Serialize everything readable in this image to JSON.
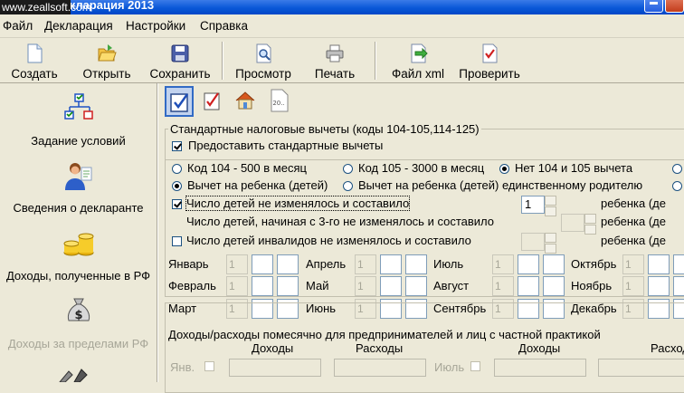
{
  "window": {
    "title": "Декларация 2013",
    "watermark": "www.zeallsoft.com"
  },
  "menu": [
    "Файл",
    "Декларация",
    "Настройки",
    "Справка"
  ],
  "toolbar": {
    "create": "Создать",
    "open": "Открыть",
    "save": "Сохранить",
    "preview": "Просмотр",
    "print": "Печать",
    "xml": "Файл xml",
    "check": "Проверить"
  },
  "sidebar": [
    {
      "label": "Задание условий",
      "icon": "org-chart-icon"
    },
    {
      "label": "Сведения о декларанте",
      "icon": "person-icon"
    },
    {
      "label": "Доходы, полученные в РФ",
      "icon": "coins-icon"
    },
    {
      "label": "Доходы за пределами РФ",
      "icon": "money-bag-icon"
    }
  ],
  "tabs": [
    "deductions-tab-icon",
    "checklist-tab-icon",
    "house-tab-icon",
    "document-20-tab-icon"
  ],
  "std": {
    "group_title": "Стандартные налоговые вычеты (коды 104-105,114-125)",
    "provide_label": "Предоставить стандартные вычеты",
    "provide_checked": true,
    "radio_row1": [
      {
        "label": "Код 104 - 500 в месяц",
        "checked": false
      },
      {
        "label": "Код 105 - 3000 в месяц",
        "checked": false
      },
      {
        "label": "Нет 104 и 105 вычета",
        "checked": true
      }
    ],
    "radio_row2": [
      {
        "label": "Вычет на ребенка (детей)",
        "checked": true
      },
      {
        "label": "Вычет на ребенка (детей) единственному родителю",
        "checked": false
      }
    ],
    "children": [
      {
        "label": "Число детей не изменялось и составило",
        "checked": true,
        "value": "1",
        "suffix": "ребенка (де"
      },
      {
        "label": "Число детей, начиная с 3-го не изменялось и составило",
        "checked": null,
        "value": "",
        "suffix": "ребенка (де"
      },
      {
        "label": "Число детей инвалидов не изменялось и составило",
        "checked": false,
        "value": "",
        "suffix": "ребенка (де"
      }
    ],
    "months": [
      [
        "Январь",
        "Апрель",
        "Июль",
        "Октябрь"
      ],
      [
        "Февраль",
        "Май",
        "Август",
        "Ноябрь"
      ],
      [
        "Март",
        "Июнь",
        "Сентябрь",
        "Декабрь"
      ]
    ],
    "month_value": "1"
  },
  "biz": {
    "group_title": "Доходы/расходы помесячно для предпринимателей и лиц с частной практикой",
    "headers": [
      "Доходы",
      "Расходы",
      "Доходы",
      "Расходы"
    ],
    "row_months": [
      "Янв.",
      "Июль"
    ]
  }
}
